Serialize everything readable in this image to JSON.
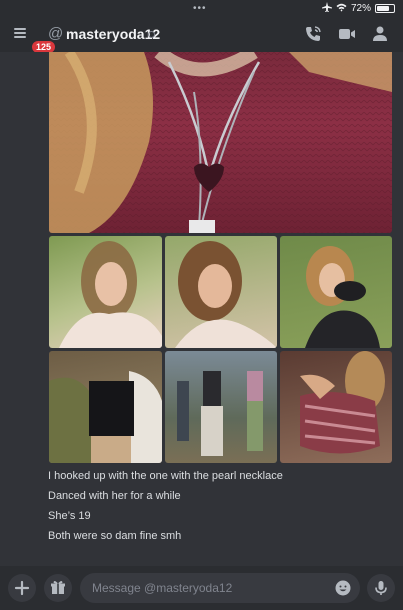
{
  "status_bar": {
    "dots": "•••",
    "battery_text": "72%",
    "battery_level": 0.72
  },
  "header": {
    "unread_badge": "125",
    "username": "masteryoda12",
    "status": "offline",
    "icons": [
      "menu-icon",
      "at-icon",
      "phone-icon",
      "video-camera-icon",
      "people-icon"
    ]
  },
  "attachments": {
    "count": 7
  },
  "messages": [
    "I hooked up with the one with the pearl necklace",
    "Danced with her for a while",
    "She’s 19",
    "Both were so dam fine smh"
  ],
  "composer": {
    "placeholder": "Message @masteryoda12",
    "icons": [
      "plus-icon",
      "gift-icon",
      "emoji-icon",
      "microphone-icon"
    ]
  },
  "colors": {
    "background": "#313338",
    "header": "#2b2d31",
    "badge": "#da373c",
    "input": "#383a40"
  }
}
